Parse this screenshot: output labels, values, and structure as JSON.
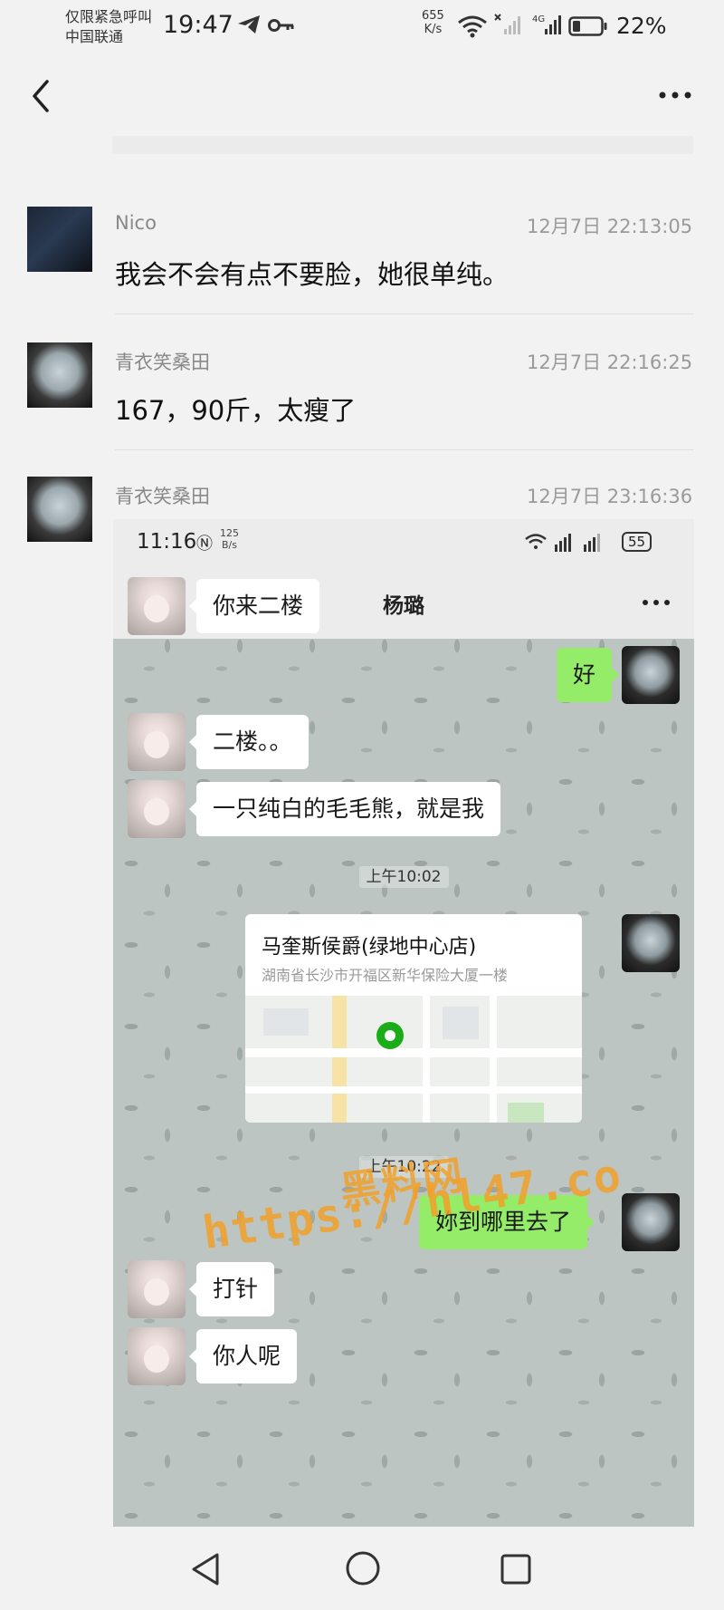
{
  "status_bar": {
    "carrier_line1": "仅限紧急呼叫",
    "carrier_line2": "中国联通",
    "time": "19:47",
    "speed_value": "655",
    "speed_unit": "K/s",
    "battery_percent": "22%",
    "network_label": "4G"
  },
  "messages": [
    {
      "sender": "Nico",
      "timestamp": "12月7日 22:13:05",
      "text": "我会不会有点不要脸，她很单纯。"
    },
    {
      "sender": "青衣笑桑田",
      "timestamp": "12月7日 22:16:25",
      "text": "167，90斤，太瘦了"
    },
    {
      "sender": "青衣笑桑田",
      "timestamp": "12月7日 23:16:36"
    }
  ],
  "embedded_screenshot": {
    "status": {
      "time": "11:16",
      "speed_value": "125",
      "speed_unit": "B/s",
      "battery": "55"
    },
    "chat_title": "杨璐",
    "chat": [
      {
        "text": "你来二楼"
      },
      {
        "text": "好"
      },
      {
        "text": "二楼。。"
      },
      {
        "text": "一只纯白的毛毛熊，就是我"
      },
      {
        "time": "上午10:02"
      },
      {
        "location_name": "马奎斯侯爵(绿地中心店)",
        "location_address": "湖南省长沙市开福区新华保险大厦一楼"
      },
      {
        "time": "上午10:22"
      },
      {
        "text": "妳到哪里去了"
      },
      {
        "text": "打针"
      },
      {
        "text": "你人呢"
      }
    ]
  },
  "watermark": {
    "line1": "黑料网",
    "line2": "https://hl47.co"
  },
  "colors": {
    "outgoing_bubble": "#95ec69",
    "incoming_bubble": "#ffffff",
    "watermark": "#f2a02a"
  }
}
